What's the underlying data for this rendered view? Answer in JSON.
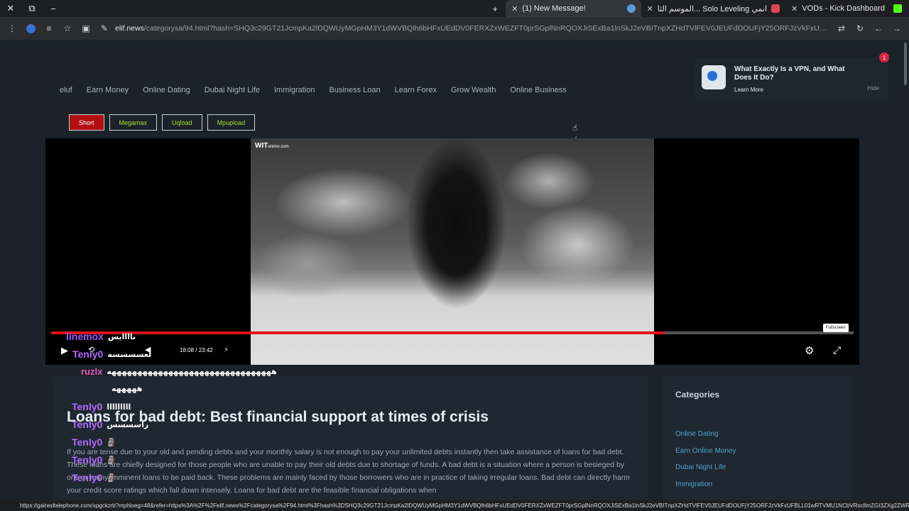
{
  "browser": {
    "tabs": [
      {
        "label": "(1) New Message!",
        "active": true
      },
      {
        "label": "الموسم الثا... Solo Leveling انمي",
        "active": false
      },
      {
        "label": "VODs - Kick Dashboard",
        "active": false
      }
    ],
    "url_host": "elif.news",
    "url_rest": "/categorysa/94.html?hash=SHQ3c29GT21JcmpKa2lDQWUyMGpHM3Y1dWVBQlh6bHFxUEdDV0FERXZxWEZFT0prSGplNnRQOXJiSExBa1lnSkJ2eVBITnpXZHdTVlFEV0JEUFdDOUFjY25ORFJzVkFxUFBLL01wRTVMU1NCbVRxclImZGI3ZXg2ZWR1...",
    "status_url": "https://gainedtelephone.com/xpgckzrb?mphloeg=48&refer=https%3A%2F%2Felif.news%2Fcategorysa%2F94.html%3Fhash%3DSHQ3c29GT21JcmpKa2lDQWUyMGpHM3Y1dWVBQlh6bHFxUEdDV0FERXZxWEZFT0prSGplNnRQOXJiSExBa1lnSkJ2eVBITnpXZHdTVlFEV0JEUFdDOUFjY25ORFJzVkFxUFBLL01wRTVMU1NCbVRxclImZGI3ZXg2ZWR1V3VaTEVtT2ZM..."
  },
  "nav": [
    "eluf",
    "Earn Money",
    "Online Dating",
    "Dubai Night Life",
    "Immigration",
    "Business Loan",
    "Learn Forex",
    "Grow Wealth",
    "Online Business"
  ],
  "notification": {
    "title": "What Exactly Is a VPN, and What Does It Do?",
    "learn_more": "Learn More",
    "hide": "Hide",
    "badge": "1"
  },
  "servers": [
    {
      "label": "Short",
      "active": true
    },
    {
      "label": "Megamax",
      "active": false
    },
    {
      "label": "Uqload",
      "active": false
    },
    {
      "label": "Mpupload",
      "active": false
    }
  ],
  "player": {
    "watermark": "WIT",
    "watermark_suffix": "anime.com",
    "time_current": "18:08",
    "time_sep": "/",
    "time_total": "23:42",
    "progress": 0.765,
    "fullscreen_tip": "Fullscreen"
  },
  "chat": [
    {
      "user": "linemox",
      "msg": "ناااايس"
    },
    {
      "user": "Tenly0",
      "msg": "لعسسسسه"
    },
    {
      "user": "ruzlx",
      "msg": "ههههههههههههههههههههههههههههههههه"
    },
    {
      "user": "",
      "msg": "هههههه"
    },
    {
      "user": "Tenly0",
      "msg": "ااااااااا"
    },
    {
      "user": "Tenly0",
      "msg": "راسسسس"
    },
    {
      "user": "Tenly0",
      "msg": "🗿"
    },
    {
      "user": "Tenly0",
      "msg": "🗿"
    },
    {
      "user": "Tenly0",
      "msg": "🗿"
    }
  ],
  "article": {
    "title": "Loans for bad debt: Best financial support at times of crisis",
    "body": "If you are tense due to your old and pending debts and your monthly salary is not enough to pay your unlimited debts instantly then take assistance of loans for bad debt. These loans are chiefly designed for those people who are unable to pay their old debts due to shortage of funds. A bad debt is a situation where a person is besieged by one or many imminent loans to be paid back. These problems are mainly faced by those borrowers who are in practice of taking irregular loans. Bad debt can directly harm your credit score ratings which fall down intensely. Loans for bad debt are the feasible financial obligations when"
  },
  "categories": {
    "title": "Categories",
    "items": [
      "Online Dating",
      "Earn Online Money",
      "Dubai Night Life",
      "Immigration"
    ]
  }
}
